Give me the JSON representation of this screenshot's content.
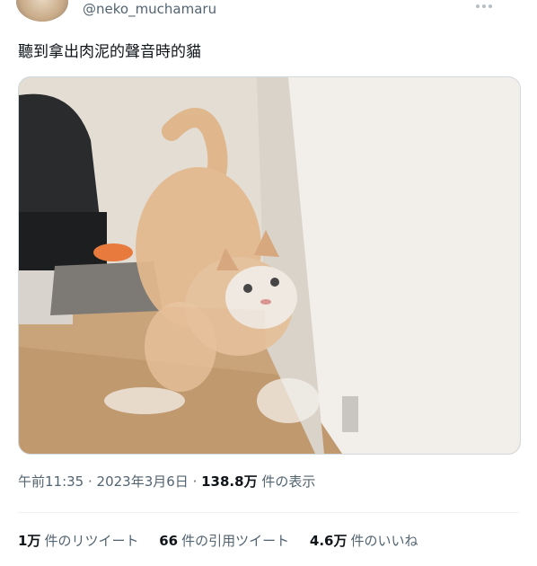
{
  "user": {
    "handle": "@neko_muchamaru",
    "avatar_icon": "cat-avatar"
  },
  "tweet": {
    "text": "聽到拿出肉泥的聲音時的貓",
    "media_alt_icon": "cat-photo"
  },
  "meta": {
    "time": "午前11:35",
    "separator1": " · ",
    "date": "2023年3月6日",
    "separator2": " · ",
    "views_count": "138.8万",
    "views_label": " 件の表示"
  },
  "stats": [
    {
      "count": "1万",
      "label": "件のリツイート"
    },
    {
      "count": "66",
      "label": "件の引用ツイート"
    },
    {
      "count": "4.6万",
      "label": "件のいいね"
    }
  ],
  "colors": {
    "text_primary": "#0f1419",
    "text_secondary": "#536471",
    "divider": "#eff3f4"
  }
}
